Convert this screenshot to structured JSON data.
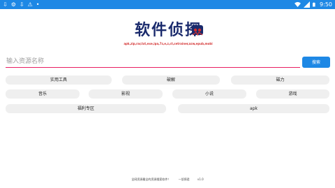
{
  "status_bar": {
    "time": "9:50",
    "left_icons": [
      "download-icon",
      "settings-icon",
      "download-icon",
      "warning-icon",
      "dot-icon"
    ],
    "background": "#1e88e5"
  },
  "logo": {
    "title": "软件侦探",
    "subtitle": "apk,zip,rar,txt,exe,ipa,7z,e,z,ct,cetrainer,azw,epub,mobi",
    "title_color": "#1a2a6c",
    "subtitle_color": "#d32f2f"
  },
  "search": {
    "placeholder": "输入资源名称",
    "value": "",
    "button_label": "搜索",
    "accent": "#e91e63",
    "button_color": "#1e88e5"
  },
  "categories": {
    "row1": [
      "实用工具",
      "破解",
      "磁力"
    ],
    "row2": [
      "音乐",
      "影视",
      "小说",
      "游戏"
    ],
    "row3": [
      "福利专区",
      "apk"
    ]
  },
  "footer": {
    "left": "全网资源最全的资源搜索软件！",
    "middle": "—侦探君",
    "version": "v1.0"
  }
}
